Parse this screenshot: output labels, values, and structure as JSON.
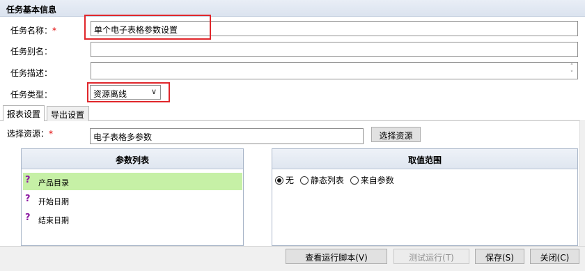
{
  "section_title": "任务基本信息",
  "form": {
    "task_name_label": "任务名称：",
    "required_mark": "*",
    "task_name_value": "单个电子表格参数设置",
    "task_alias_label": "任务别名：",
    "task_alias_value": "",
    "task_desc_label": "任务描述：",
    "task_desc_value": "",
    "task_type_label": "任务类型：",
    "task_type_value": "资源离线"
  },
  "tabs": [
    {
      "label": "报表设置",
      "active": true
    },
    {
      "label": "导出设置",
      "active": false
    }
  ],
  "resource": {
    "label": "选择资源：",
    "value": "电子表格多参数",
    "button_label": "选择资源"
  },
  "param_list": {
    "header": "参数列表",
    "items": [
      {
        "label": "产品目录",
        "selected": true
      },
      {
        "label": "开始日期",
        "selected": false
      },
      {
        "label": "结束日期",
        "selected": false
      }
    ]
  },
  "value_range": {
    "header": "取值范围",
    "options": [
      {
        "label": "无",
        "checked": true
      },
      {
        "label": "静态列表",
        "checked": false
      },
      {
        "label": "来自参数",
        "checked": false
      }
    ]
  },
  "footer": {
    "view_script_label": "查看运行脚本(V)",
    "test_run_label": "测试运行(T)",
    "save_label": "保存(S)",
    "close_label": "关闭(C)"
  },
  "colors": {
    "highlight_box": "#e0262b",
    "selected_row": "#c6f0a6",
    "required": "#e00000"
  }
}
